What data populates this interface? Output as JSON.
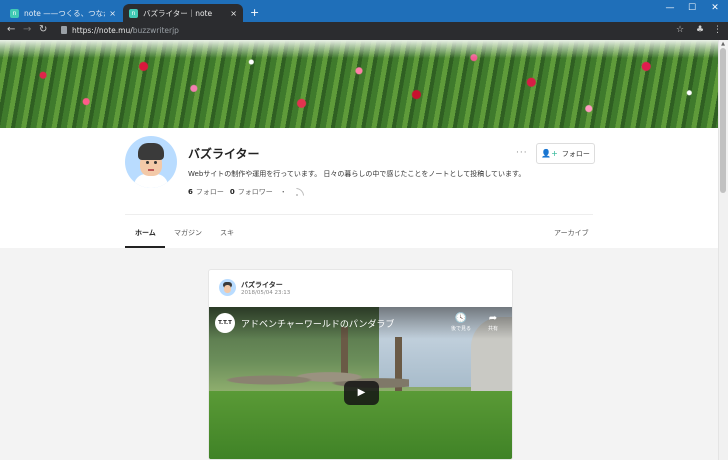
{
  "browser": {
    "tabs": [
      {
        "favicon": "n",
        "title": "note ——つくる、つながる、とどける。",
        "close": "×"
      },
      {
        "favicon": "n",
        "title": "バズライター｜note",
        "close": "×"
      }
    ],
    "new_tab": "+",
    "window_controls": {
      "minimize": "—",
      "maximize": "☐",
      "close": "✕"
    },
    "url_host": "https://note.mu/",
    "url_path": "buzzwriterjp",
    "nav": {
      "back": "←",
      "forward": "→",
      "reload": "↻"
    },
    "toolbar_icons": {
      "star": "☆",
      "extension": "♣",
      "menu": "⋮"
    }
  },
  "profile": {
    "name": "バズライター",
    "bio": "Webサイトの制作や運用を行っています。 日々の暮らしの中で感じたことをノートとして投稿しています。",
    "following_count": "6",
    "following_label": "フォロー",
    "followers_count": "0",
    "followers_label": "フォロワー",
    "sep": "・",
    "more": "···",
    "follow_icon": "👤+",
    "follow_label": "フォロー"
  },
  "nav_tabs": {
    "home": "ホーム",
    "magazine": "マガジン",
    "suki": "スキ",
    "archive": "アーカイブ"
  },
  "post": {
    "author": "バズライター",
    "date": "2018/05/04 23:13",
    "video": {
      "channel": "T.T.T",
      "title": "アドベンチャーワールドのパンダラブ",
      "watch_later_icon": "🕓",
      "watch_later": "後で見る",
      "share_icon": "➦",
      "share": "共有",
      "play": "▶"
    }
  }
}
